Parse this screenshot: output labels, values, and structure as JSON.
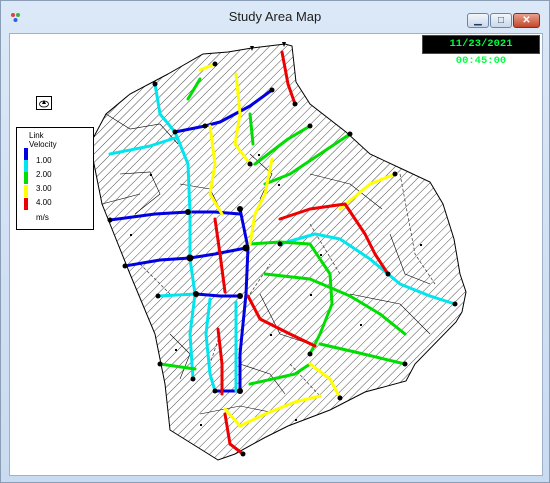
{
  "window": {
    "title": "Study Area Map",
    "controls": {
      "minimize_glyph": "▁",
      "maximize_glyph": "□",
      "close_glyph": "✕"
    }
  },
  "clock": {
    "text": "11/23/2021 00:45:00",
    "color": "#00ff40"
  },
  "legend": {
    "title_line1": "Link",
    "title_line2": "Velocity",
    "unit": "m/s",
    "bins": [
      {
        "label": "1.00",
        "color": "#0000e0"
      },
      {
        "label": "2.00",
        "color": "#00e5ee"
      },
      {
        "label": "3.00",
        "color": "#00dd00"
      },
      {
        "label": "4.00",
        "color": "#ffff00"
      },
      {
        "label": "",
        "color": "#ee0000"
      }
    ]
  },
  "icons": {
    "app": "app-icon",
    "compass": "compass-icon"
  }
}
